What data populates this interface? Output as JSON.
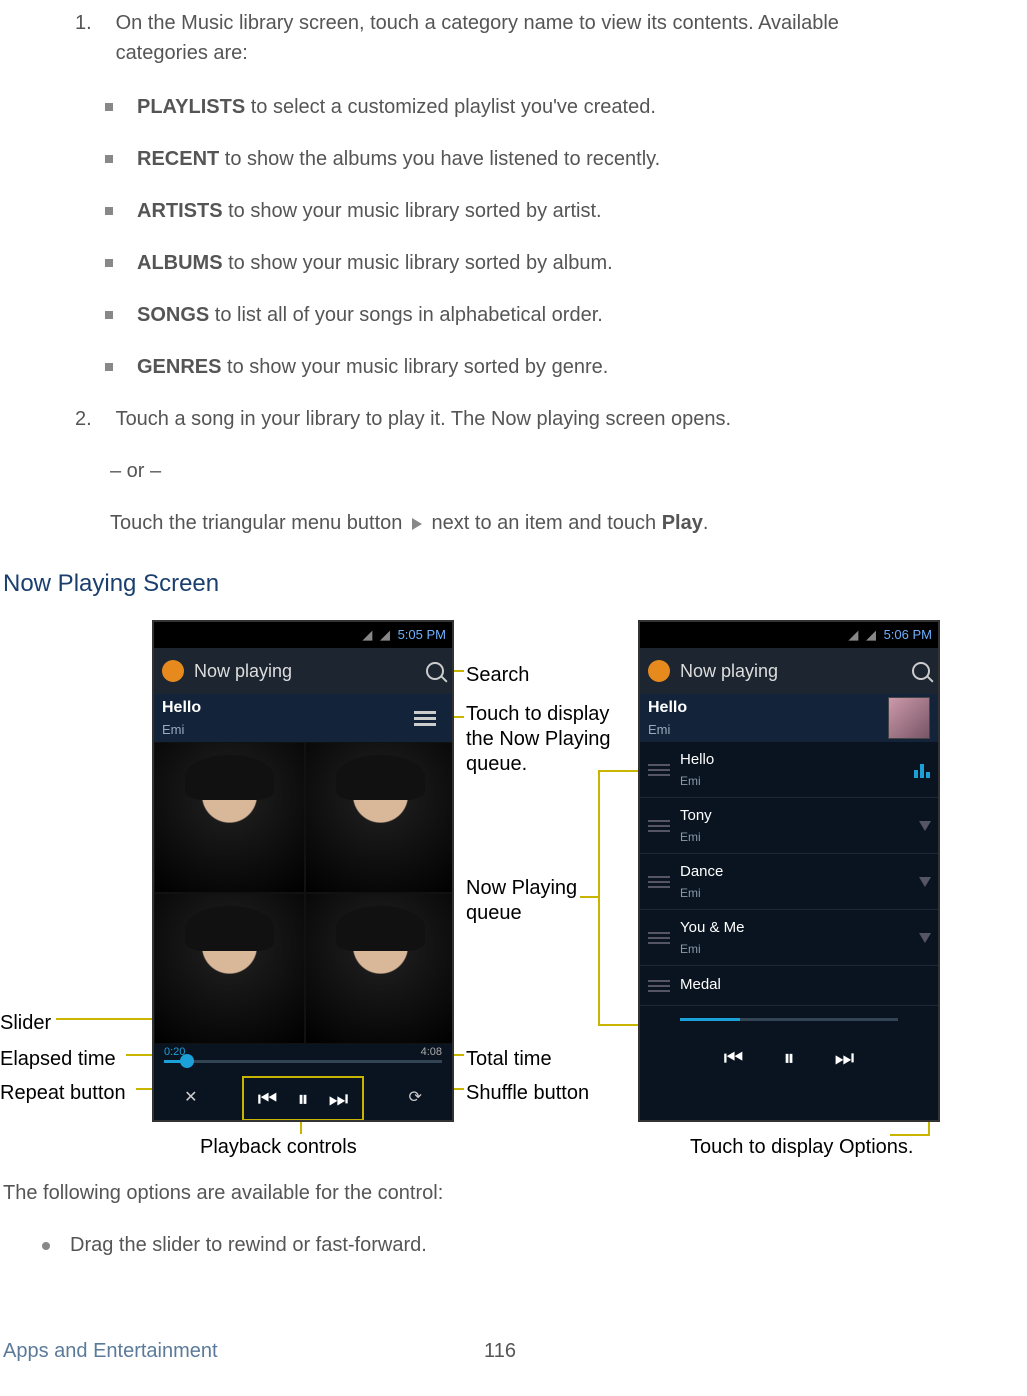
{
  "step1": {
    "num": "1.",
    "text": "On the Music library screen, touch a category name to view its contents. Available categories are:",
    "items": [
      {
        "bold": "PLAYLISTS",
        "rest": " to select a customized playlist you've created."
      },
      {
        "bold": "RECENT",
        "rest": " to show the albums you have listened to recently."
      },
      {
        "bold": "ARTISTS",
        "rest": " to show your music library sorted by artist."
      },
      {
        "bold": "ALBUMS",
        "rest": " to show your music library sorted by album."
      },
      {
        "bold": "SONGS",
        "rest": " to list all of your songs in alphabetical order."
      },
      {
        "bold": "GENRES",
        "rest": " to show your music library sorted by genre."
      }
    ]
  },
  "step2": {
    "num": "2.",
    "text": "Touch a song in your library to play it. The Now playing screen opens.",
    "or": "– or –",
    "alt_pre": "Touch the triangular menu button ",
    "alt_post": " next to an item and touch ",
    "play": "Play",
    "period": "."
  },
  "section_heading": "Now Playing Screen",
  "phone1": {
    "time": "5:05 PM",
    "nowplaying": "Now playing",
    "song": "Hello",
    "artist": "Emi",
    "elapsed": "0:20",
    "total": "4:08"
  },
  "phone2": {
    "time": "5:06 PM",
    "nowplaying": "Now playing",
    "song": "Hello",
    "artist": "Emi",
    "queue": [
      {
        "t": "Hello",
        "a": "Emi",
        "playing": true
      },
      {
        "t": "Tony",
        "a": "Emi",
        "playing": false
      },
      {
        "t": "Dance",
        "a": "Emi",
        "playing": false
      },
      {
        "t": "You & Me",
        "a": "Emi",
        "playing": false
      },
      {
        "t": "Medal",
        "a": "",
        "playing": false
      }
    ]
  },
  "callouts": {
    "search": "Search",
    "queue_btn": "Touch to display the Now Playing queue.",
    "queue_list": "Now Playing queue",
    "slider": "Slider",
    "elapsed": "Elapsed time",
    "repeat": "Repeat button",
    "total": "Total time",
    "shuffle": "Shuffle button",
    "playback": "Playback controls",
    "options": "Touch to display Options."
  },
  "after": {
    "intro": "The following options are available for the control:",
    "bullet1": "Drag the slider to rewind or fast-forward."
  },
  "footer": {
    "section": "Apps and Entertainment",
    "page": "116"
  }
}
